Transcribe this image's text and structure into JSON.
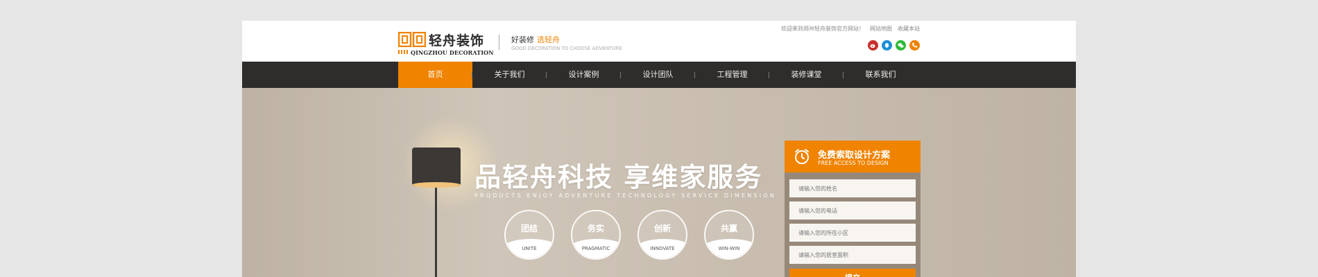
{
  "header": {
    "logo_cn": "轻舟装饰",
    "logo_en": "QINGZHOU DECORATION",
    "slogan_main": "好装修",
    "slogan_accent": "选轻舟",
    "slogan_en": "GOOD DECORATION TO CHOOSE ADVENTURE",
    "top_links": {
      "welcome": "欢迎来到郑州轻舟装饰官方网站！",
      "sitemap": "网站地图",
      "favorite": "收藏本站"
    },
    "social_icons": [
      "weibo-icon",
      "qq-icon",
      "wechat-icon",
      "phone-icon"
    ]
  },
  "nav": {
    "items": [
      {
        "label": "首页",
        "active": true
      },
      {
        "label": "关于我们"
      },
      {
        "label": "设计案例"
      },
      {
        "label": "设计团队"
      },
      {
        "label": "工程管理"
      },
      {
        "label": "装修课堂"
      },
      {
        "label": "联系我们"
      }
    ]
  },
  "banner": {
    "headline": "品轻舟科技  享维家服务",
    "subline": "PRODUCTS ENJOY ADVENTURE TECHNOLOGY SERVICE DIMENSION",
    "values": [
      {
        "cn": "团结",
        "en": "UNITE"
      },
      {
        "cn": "务实",
        "en": "PRAGMATIC"
      },
      {
        "cn": "创新",
        "en": "INNOVATE"
      },
      {
        "cn": "共赢",
        "en": "WIN-WIN"
      }
    ]
  },
  "form": {
    "title": "免费索取设计方案",
    "title_en": "FREE ACCESS TO DESIGN",
    "fields": {
      "name": "请输入您的姓名",
      "phone": "请输入您的电话",
      "community": "请输入您的所在小区",
      "area": "请输入您的居室面积"
    },
    "submit": "提交"
  },
  "colors": {
    "accent": "#f08300",
    "nav_bg": "#2f2d2b",
    "page_bg": "#e6e6e6"
  }
}
